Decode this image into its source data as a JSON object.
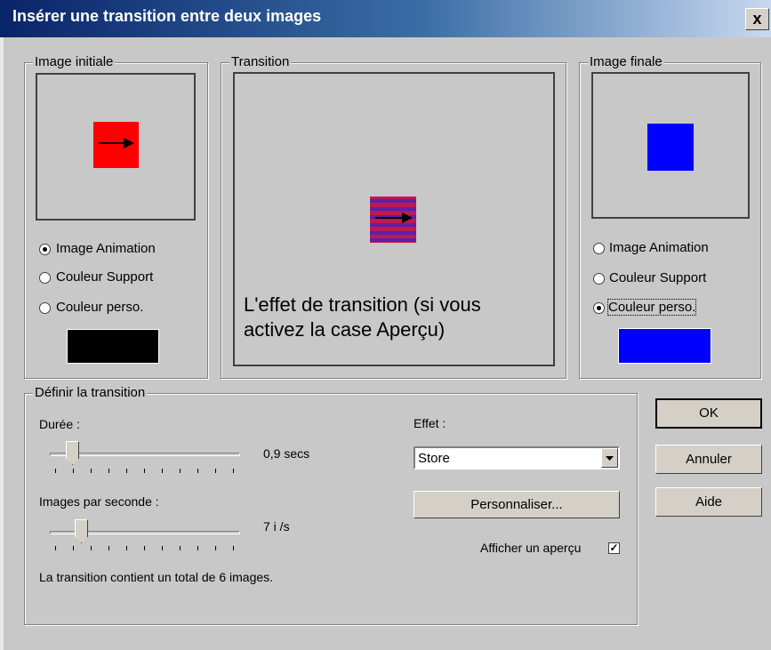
{
  "window": {
    "title": "Insérer une transition entre deux images",
    "close_label": "x"
  },
  "initial": {
    "legend": "Image initiale",
    "options": [
      "Image Animation",
      "Couleur Support",
      "Couleur perso."
    ],
    "selected": 0,
    "swatch_color": "#000000",
    "image_color": "#ff0000"
  },
  "transition": {
    "legend": "Transition",
    "annotation_line1": "L'effet de transition (si vous",
    "annotation_line2": "activez la case Aperçu)"
  },
  "final": {
    "legend": "Image finale",
    "options": [
      "Image Animation",
      "Couleur Support",
      "Couleur perso."
    ],
    "selected": 2,
    "swatch_color": "#0000ff",
    "image_color": "#0000ff"
  },
  "define": {
    "legend": "Définir la transition",
    "duration_label": "Durée :",
    "duration_value": "0,9 secs",
    "fps_label": "Images par seconde :",
    "fps_value": "7 i /s",
    "summary": "La transition contient un total de 6 images.",
    "effect_label": "Effet :",
    "effect_value": "Store",
    "customize_label": "Personnaliser...",
    "preview_label": "Afficher un aperçu",
    "preview_checked": true
  },
  "buttons": {
    "ok": "OK",
    "cancel": "Annuler",
    "help": "Aide"
  }
}
